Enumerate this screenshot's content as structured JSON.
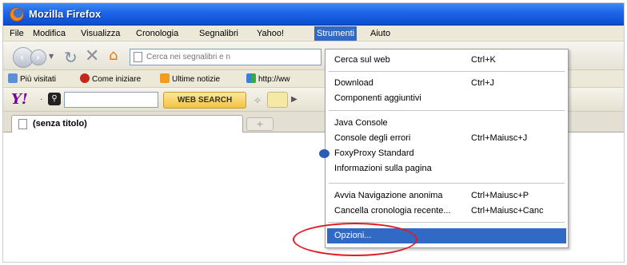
{
  "window": {
    "title": "Mozilla Firefox"
  },
  "menubar": {
    "items": [
      "File",
      "Modifica",
      "Visualizza",
      "Cronologia",
      "Segnalibri",
      "Yahoo!",
      "Strumenti",
      "Aiuto"
    ],
    "active": "Strumenti"
  },
  "navbar": {
    "search_placeholder": "Cerca nei segnalibri e n"
  },
  "bookmarks": {
    "items": [
      "Più visitati",
      "Come iniziare",
      "Ultime notizie",
      "http://ww"
    ]
  },
  "yahoo_toolbar": {
    "search_button": "WEB SEARCH"
  },
  "tabs": [
    {
      "label": "(senza titolo)"
    }
  ],
  "dropdown": {
    "groups": [
      [
        {
          "label": "Cerca sul web",
          "shortcut": "Ctrl+K"
        }
      ],
      [
        {
          "label": "Download",
          "shortcut": "Ctrl+J"
        },
        {
          "label": "Componenti aggiuntivi",
          "shortcut": ""
        }
      ],
      [
        {
          "label": "Java Console",
          "shortcut": ""
        },
        {
          "label": "Console degli errori",
          "shortcut": "Ctrl+Maiusc+J"
        },
        {
          "label": "FoxyProxy Standard",
          "shortcut": ""
        },
        {
          "label": "Informazioni sulla pagina",
          "shortcut": ""
        }
      ],
      [
        {
          "label": "Avvia Navigazione anonima",
          "shortcut": "Ctrl+Maiusc+P"
        },
        {
          "label": "Cancella cronologia recente...",
          "shortcut": "Ctrl+Maiusc+Canc"
        }
      ],
      [
        {
          "label": "Opzioni...",
          "shortcut": ""
        }
      ]
    ],
    "highlighted": "Opzioni..."
  },
  "colors": {
    "accent": "#316ac5",
    "titlebar": "#1f63e6",
    "annotation": "#e01b24"
  }
}
